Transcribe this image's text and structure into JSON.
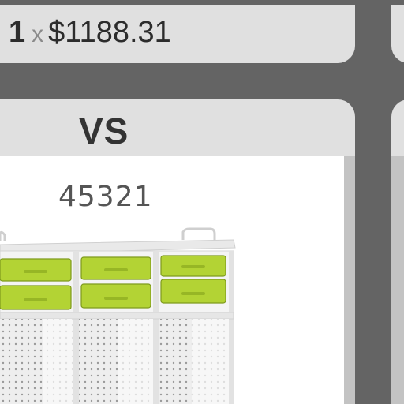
{
  "cart_line": {
    "quantity": "1",
    "times_symbol": "x",
    "price": "$1188.31"
  },
  "compare": {
    "label": "VS"
  },
  "product": {
    "id": "45321",
    "image_icon": "storage-cabinet-with-trays-image",
    "tray_color": "#b3d334"
  },
  "colors": {
    "background": "#646464",
    "panel": "#e0e0e0",
    "card": "#ffffff"
  }
}
